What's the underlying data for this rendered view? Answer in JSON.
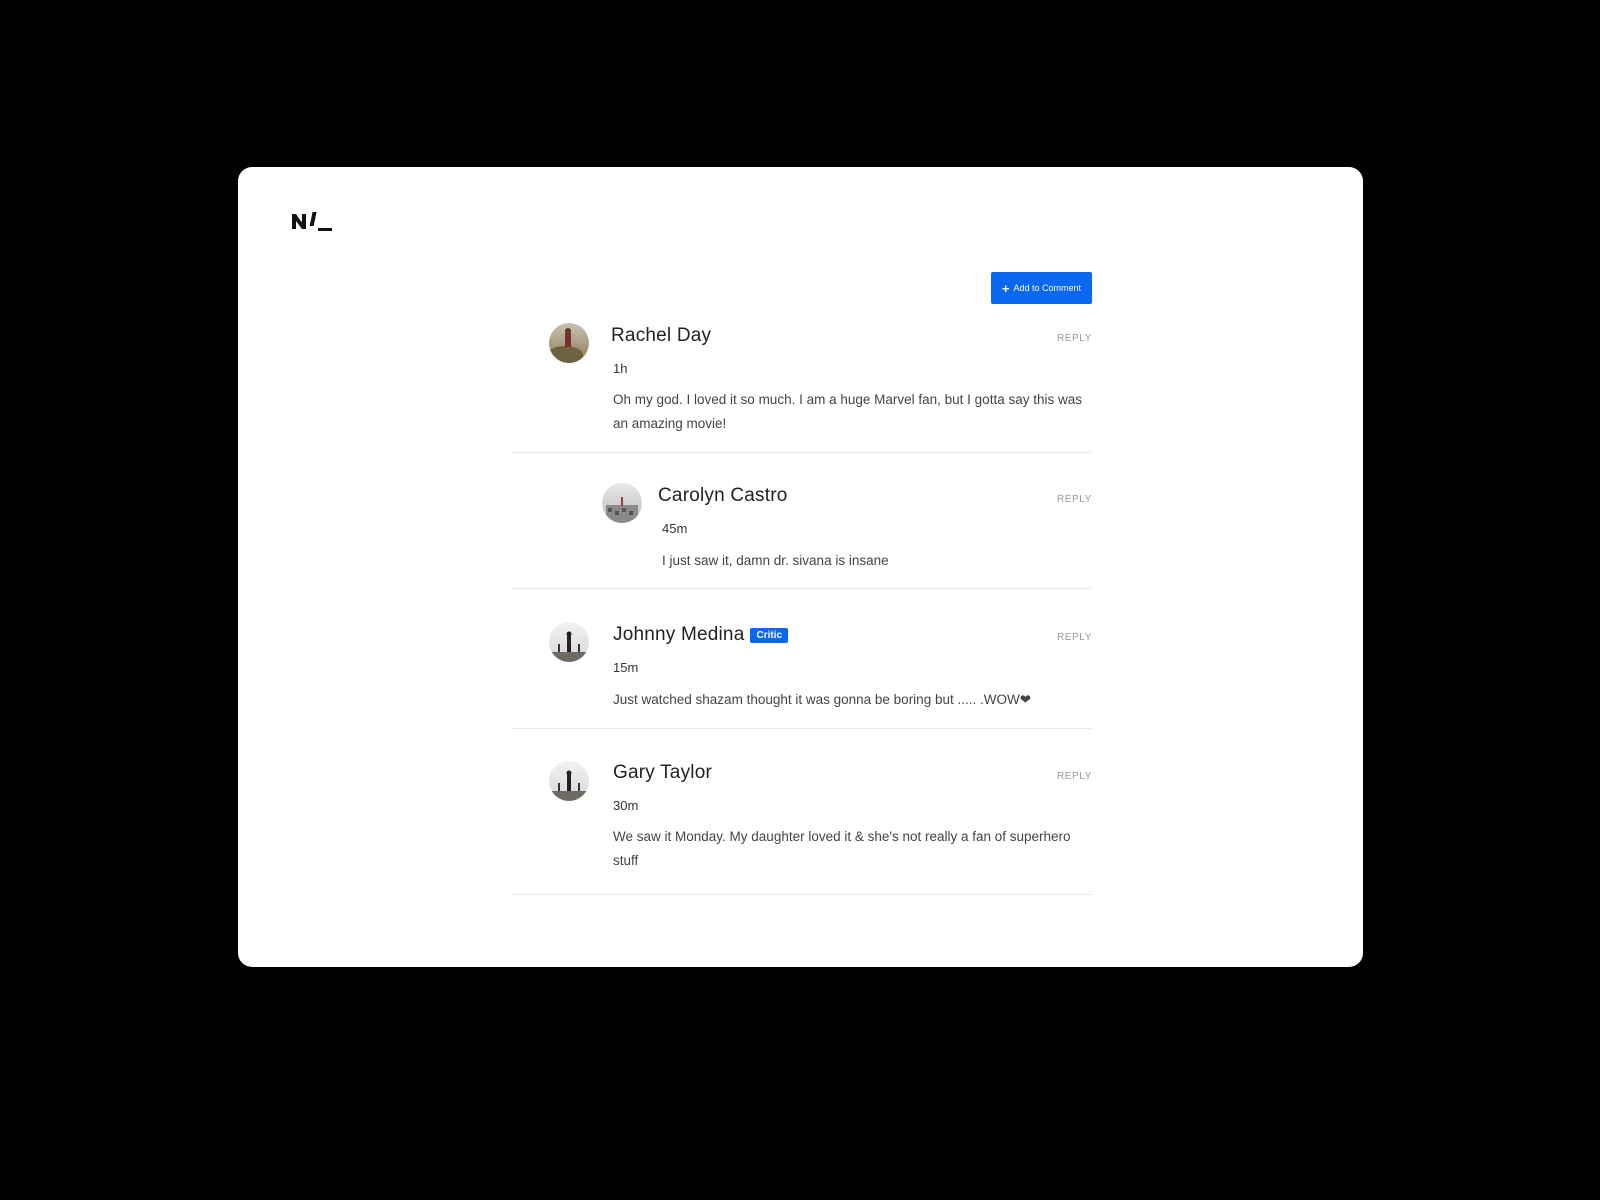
{
  "brand": {
    "logo_text": "ML"
  },
  "toolbar": {
    "add_comment_label": "Add to Comment",
    "add_icon": "plus-icon"
  },
  "comments": [
    {
      "name": "Rachel Day",
      "time": "1h",
      "text": "Oh my god. I loved it so much. I am a huge Marvel fan, but I gotta say this was an amazing movie!",
      "reply_label": "REPLY",
      "badge": ""
    },
    {
      "name": "Carolyn Castro",
      "time": "45m",
      "text": "I just saw it, damn dr. sivana is insane",
      "reply_label": "REPLY",
      "badge": ""
    },
    {
      "name": "Johnny Medina",
      "time": "15m",
      "text": "Just watched shazam thought it was gonna be boring but ..... .WOW❤",
      "reply_label": "REPLY",
      "badge": "Critic"
    },
    {
      "name": "Gary Taylor",
      "time": "30m",
      "text": "We saw it Monday. My daughter loved it & she's not really a fan of superhero stuff",
      "reply_label": "REPLY",
      "badge": ""
    }
  ],
  "colors": {
    "accent": "#0a67f0",
    "background": "#000000",
    "card": "#ffffff"
  }
}
